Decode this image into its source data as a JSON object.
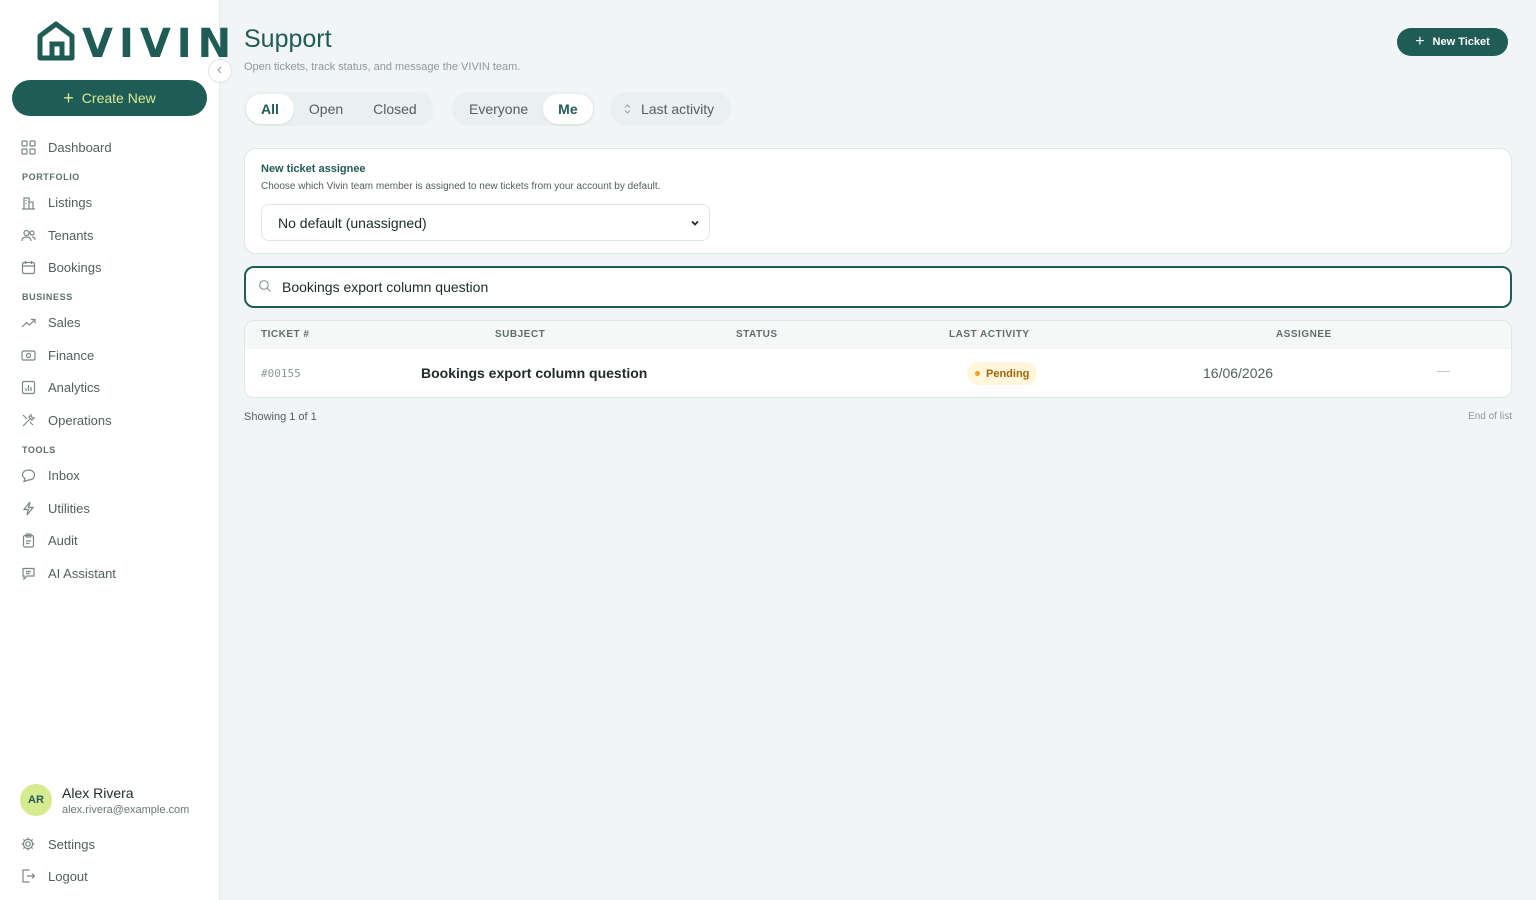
{
  "brand": {
    "name": "VIVIN"
  },
  "sidebar": {
    "create_label": "Create New",
    "dashboard": "Dashboard",
    "sections": {
      "portfolio": "PORTFOLIO",
      "business": "BUSINESS",
      "tools": "TOOLS"
    },
    "items": {
      "listings": "Listings",
      "tenants": "Tenants",
      "bookings": "Bookings",
      "sales": "Sales",
      "finance": "Finance",
      "analytics": "Analytics",
      "operations": "Operations",
      "inbox": "Inbox",
      "utilities": "Utilities",
      "audit": "Audit",
      "ai_assistant": "AI Assistant"
    },
    "user": {
      "initials": "AR",
      "name": "Alex Rivera",
      "email": "alex.rivera@example.com"
    },
    "settings": "Settings",
    "logout": "Logout"
  },
  "header": {
    "title": "Support",
    "subtitle": "Open tickets, track status, and message the VIVIN team.",
    "new_ticket_label": "New Ticket"
  },
  "filters": {
    "status": [
      "All",
      "Open",
      "Closed"
    ],
    "owner": [
      "Everyone",
      "Me"
    ],
    "sort_label": "Last activity"
  },
  "assignee_card": {
    "title": "New ticket assignee",
    "description": "Choose which Vivin team member is assigned to new tickets from your account by default.",
    "selected": "No default (unassigned)"
  },
  "search": {
    "value": "Bookings export column question"
  },
  "table": {
    "columns": [
      "TICKET #",
      "SUBJECT",
      "STATUS",
      "LAST ACTIVITY",
      "ASSIGNEE"
    ],
    "rows": [
      {
        "ticket": "#00155",
        "subject": "Bookings export column question",
        "status": "Pending",
        "last_activity": "16/06/2026",
        "assignee": "—"
      }
    ]
  },
  "footer": {
    "showing": "Showing 1 of 1",
    "end": "End of list"
  },
  "colors": {
    "primary": "#1f5c55",
    "accent": "#d6ea8f",
    "pending_bg": "#fff6dc",
    "pending_text": "#a1650a"
  }
}
